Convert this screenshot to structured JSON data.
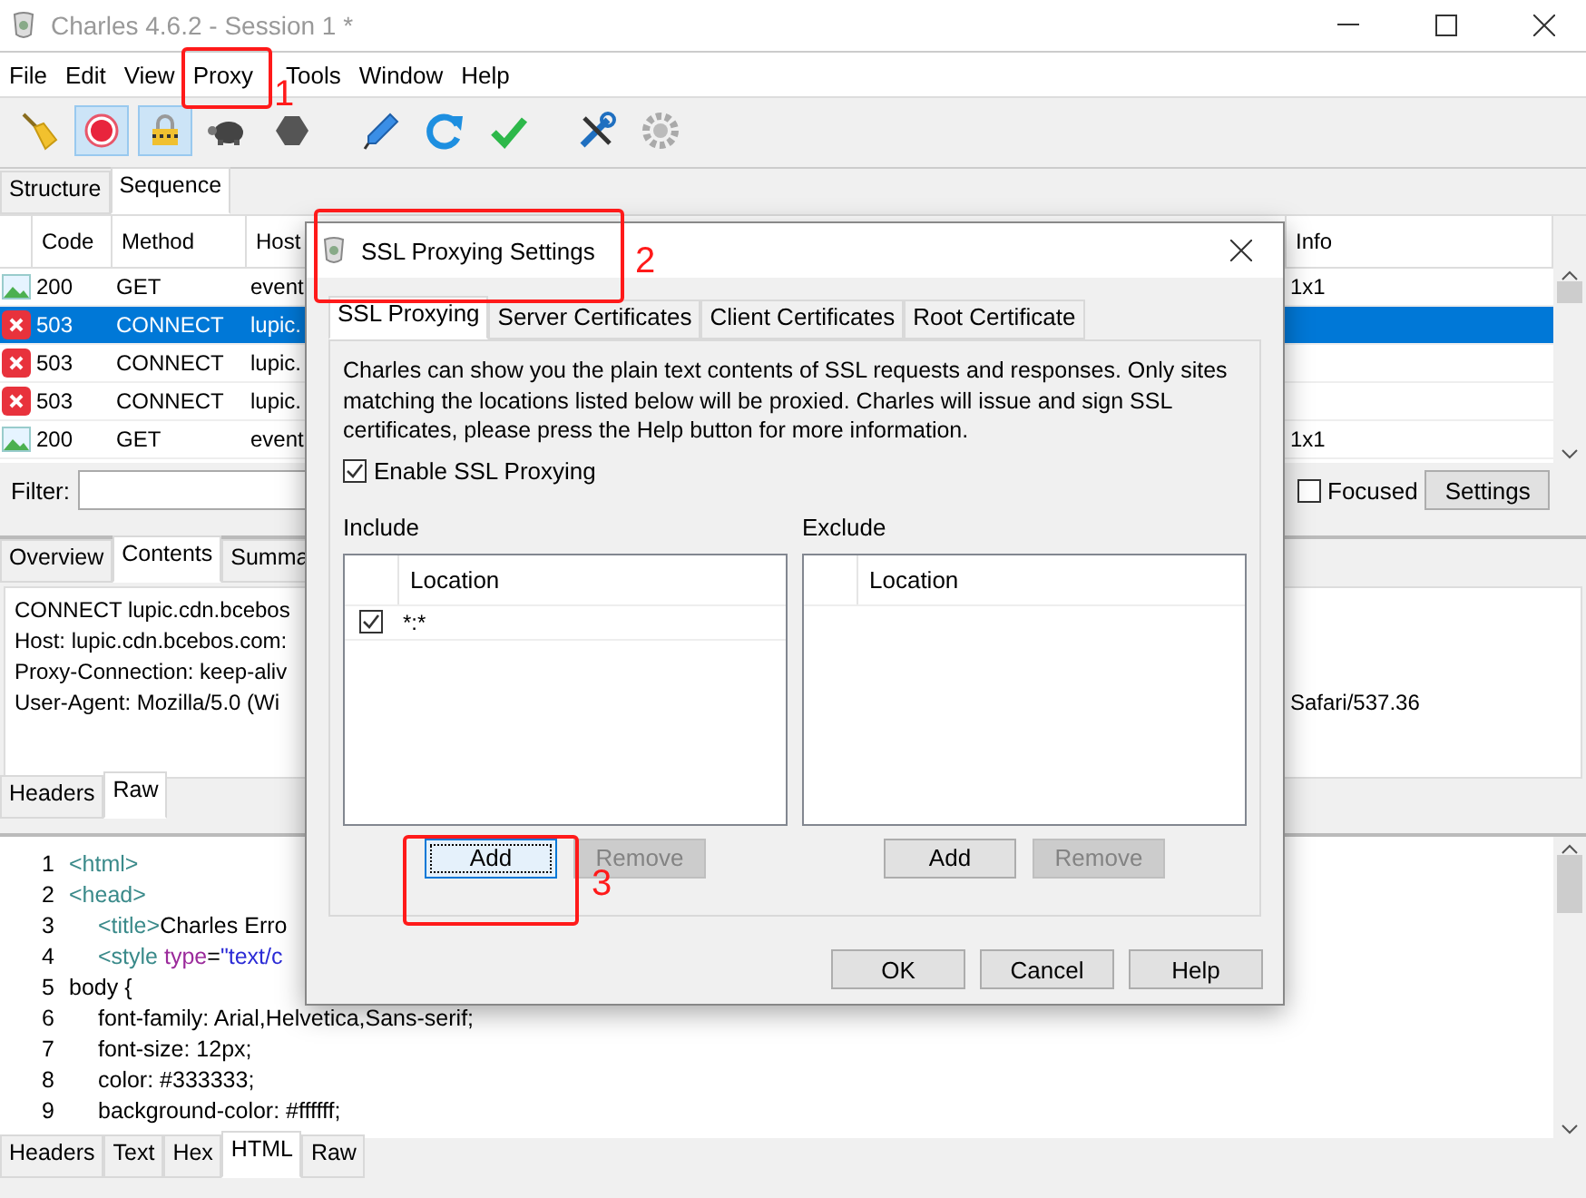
{
  "window": {
    "title": "Charles 4.6.2 - Session 1 *"
  },
  "menu": [
    {
      "label": "File"
    },
    {
      "label": "Edit"
    },
    {
      "label": "View"
    },
    {
      "label": "Proxy"
    },
    {
      "label": "Tools"
    },
    {
      "label": "Window"
    },
    {
      "label": "Help"
    }
  ],
  "toolbar": [
    {
      "kind": "broom",
      "on": false
    },
    {
      "kind": "record",
      "on": true
    },
    {
      "kind": "lock",
      "on": true
    },
    {
      "kind": "turtle",
      "on": false
    },
    {
      "kind": "stop",
      "on": false
    },
    {
      "kind": "pen",
      "on": false
    },
    {
      "kind": "refresh",
      "on": false
    },
    {
      "kind": "check",
      "on": false
    },
    {
      "kind": "tools",
      "on": false
    },
    {
      "kind": "gear",
      "on": false
    }
  ],
  "view_tabs": [
    {
      "label": "Structure",
      "selected": false
    },
    {
      "label": "Sequence",
      "selected": true
    }
  ],
  "table": {
    "columns": [
      "Code",
      "Method",
      "Host",
      "Info"
    ],
    "rows": [
      {
        "kind": "image",
        "code": "200",
        "method": "GET",
        "host": "event",
        "info": "1x1",
        "selected": false
      },
      {
        "kind": "error",
        "code": "503",
        "method": "CONNECT",
        "host": "lupic.",
        "info": "",
        "selected": true
      },
      {
        "kind": "error",
        "code": "503",
        "method": "CONNECT",
        "host": "lupic.",
        "info": "",
        "selected": false
      },
      {
        "kind": "error",
        "code": "503",
        "method": "CONNECT",
        "host": "lupic.",
        "info": "",
        "selected": false
      },
      {
        "kind": "image",
        "code": "200",
        "method": "GET",
        "host": "event",
        "info": "1x1",
        "selected": false
      }
    ]
  },
  "filter": {
    "label": "Filter:",
    "focused_label": "Focused",
    "focused_checked": false,
    "settings_button": "Settings"
  },
  "detail_tabs": [
    {
      "label": "Overview",
      "selected": false
    },
    {
      "label": "Contents",
      "selected": true
    },
    {
      "label": "Summa",
      "selected": false
    }
  ],
  "request_lines": [
    {
      "text": "CONNECT lupic.cdn.bcebos"
    },
    {
      "text": "Host: lupic.cdn.bcebos.com:"
    },
    {
      "text": "Proxy-Connection: keep-aliv"
    },
    {
      "text": "User-Agent: Mozilla/5.0 (Wi",
      "tail": "Safari/537.36"
    }
  ],
  "request_tabs": [
    {
      "label": "Headers",
      "selected": false
    },
    {
      "label": "Raw",
      "selected": true
    }
  ],
  "code_lines": [
    {
      "number": "1",
      "indented": false,
      "segments": [
        {
          "kind": "tag",
          "text": "<html>"
        }
      ]
    },
    {
      "number": "2",
      "indented": false,
      "segments": [
        {
          "kind": "tag",
          "text": "<head>"
        }
      ]
    },
    {
      "number": "3",
      "indented": true,
      "segments": [
        {
          "kind": "tag",
          "text": "<title>"
        },
        {
          "kind": "plain",
          "text": "Charles Erro"
        }
      ]
    },
    {
      "number": "4",
      "indented": true,
      "segments": [
        {
          "kind": "tag",
          "text": "<style"
        },
        {
          "kind": "attr",
          "text": " type"
        },
        {
          "kind": "plain",
          "text": "="
        },
        {
          "kind": "string",
          "text": "\"text/c"
        }
      ]
    },
    {
      "number": "5",
      "indented": false,
      "segments": [
        {
          "kind": "plain",
          "text": "body {"
        }
      ]
    },
    {
      "number": "6",
      "indented": true,
      "segments": [
        {
          "kind": "plain",
          "text": "font-family: Arial,Helvetica,Sans-serif;"
        }
      ]
    },
    {
      "number": "7",
      "indented": true,
      "segments": [
        {
          "kind": "plain",
          "text": "font-size: 12px;"
        }
      ]
    },
    {
      "number": "8",
      "indented": true,
      "segments": [
        {
          "kind": "plain",
          "text": "color: #333333;"
        }
      ]
    },
    {
      "number": "9",
      "indented": true,
      "segments": [
        {
          "kind": "plain",
          "text": "background-color: #ffffff;"
        }
      ]
    }
  ],
  "response_tabs": [
    {
      "label": "Headers",
      "selected": false
    },
    {
      "label": "Text",
      "selected": false
    },
    {
      "label": "Hex",
      "selected": false
    },
    {
      "label": "HTML",
      "selected": true
    },
    {
      "label": "Raw",
      "selected": false
    }
  ],
  "dialog": {
    "title": "SSL Proxying Settings",
    "tabs": [
      {
        "label": "SSL Proxying",
        "selected": true
      },
      {
        "label": "Server Certificates",
        "selected": false
      },
      {
        "label": "Client Certificates",
        "selected": false
      },
      {
        "label": "Root Certificate",
        "selected": false
      }
    ],
    "description": "Charles can show you the plain text contents of SSL requests and responses. Only sites matching the locations listed below will be proxied. Charles will issue and sign SSL certificates, please press the Help button for more information.",
    "enable": {
      "label": "Enable SSL Proxying",
      "checked": true
    },
    "lists": [
      {
        "title": "Include",
        "column": "Location",
        "rows": [
          {
            "location": "*:*",
            "checked": true
          }
        ],
        "buttons": [
          {
            "label": "Add",
            "focused": true,
            "disabled": false
          },
          {
            "label": "Remove",
            "focused": false,
            "disabled": true
          }
        ]
      },
      {
        "title": "Exclude",
        "column": "Location",
        "buttons": [
          {
            "label": "Add",
            "focused": false,
            "disabled": false
          },
          {
            "label": "Remove",
            "focused": false,
            "disabled": true
          }
        ]
      }
    ],
    "buttons": [
      {
        "label": "OK"
      },
      {
        "label": "Cancel"
      },
      {
        "label": "Help"
      }
    ]
  },
  "annotations": [
    {
      "number": "1"
    },
    {
      "number": "2"
    },
    {
      "number": "3"
    }
  ]
}
